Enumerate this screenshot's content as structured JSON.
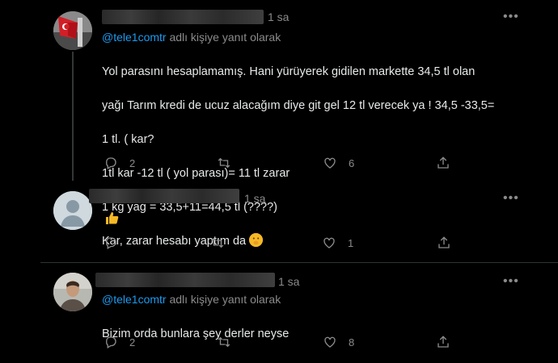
{
  "tweets": [
    {
      "time": "1 sa",
      "reply_prefix": "@tele1comtr",
      "reply_suffix": " adlı kişiye yanıt olarak",
      "lines": [
        "Yol parasını hesaplamamış.  Hani yürüyerek gidilen markette 34,5 tl olan",
        "yağı Tarım kredi de ucuz alacağım diye git gel 12 tl verecek ya ! 34,5 -33,5=",
        "1 tl. ( kar?",
        "1tl kar -12 tl ( yol parası)= 11 tl zarar",
        "1 kg yağ = 33,5+11=44,5 tl (????)",
        "Kar,  zarar hesabı yaptım da"
      ],
      "counts": {
        "reply": "2",
        "retweet": "",
        "like": "6"
      }
    },
    {
      "time": "1 sa",
      "counts": {
        "reply": "",
        "retweet": "",
        "like": "1"
      }
    },
    {
      "time": "1 sa",
      "reply_prefix": "@tele1comtr",
      "reply_suffix": " adlı kişiye yanıt olarak",
      "lines": [
        "Bizim orda bunlara şey derler neyse"
      ],
      "counts": {
        "reply": "2",
        "retweet": "",
        "like": "8"
      }
    }
  ],
  "more_label": "•••",
  "colors": {
    "background": "#000000",
    "text": "#e7e9ea",
    "muted": "#8b8b8b",
    "link": "#1d9bf0"
  },
  "icons": [
    "reply-icon",
    "retweet-icon",
    "like-icon",
    "share-icon",
    "more-icon",
    "thumbs-up-emoji",
    "shushing-face-emoji"
  ]
}
